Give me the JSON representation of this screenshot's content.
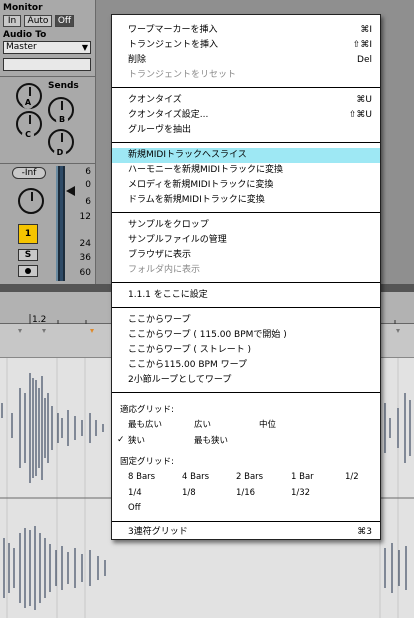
{
  "mixer": {
    "monitor_label": "Monitor",
    "monitor_in": "In",
    "monitor_auto": "Auto",
    "monitor_off": "Off",
    "audio_to_label": "Audio To",
    "audio_to_value": "Master",
    "sends_label": "Sends",
    "send_a": "A",
    "send_b": "B",
    "send_c": "C",
    "send_d": "D",
    "volume": "-Inf",
    "track_number": "1",
    "solo": "S",
    "scale": [
      "6",
      "0",
      "6",
      "12",
      "24",
      "36",
      "60"
    ]
  },
  "ruler": {
    "bar_label": "1.2"
  },
  "menu": {
    "insert_warp_marker": "ワープマーカーを挿入",
    "insert_warp_marker_sc": "⌘I",
    "insert_transient": "トランジェントを挿入",
    "insert_transient_sc": "⇧⌘I",
    "delete": "削除",
    "delete_sc": "Del",
    "reset_transients": "トランジェントをリセット",
    "quantize": "クオンタイズ",
    "quantize_sc": "⌘U",
    "quantize_settings": "クオンタイズ設定...",
    "quantize_settings_sc": "⇧⌘U",
    "extract_groove": "グルーヴを抽出",
    "slice_to_midi": "新規MIDIトラックへスライス",
    "harmony_to_midi": "ハーモニーを新規MIDIトラックに変換",
    "melody_to_midi": "メロディを新規MIDIトラックに変換",
    "drums_to_midi": "ドラムを新規MIDIトラックに変換",
    "crop_sample": "サンプルをクロップ",
    "manage_sample_file": "サンプルファイルの管理",
    "show_in_browser": "ブラウザに表示",
    "show_in_folder": "フォルダ内に表示",
    "set_1_1_1_here": "1.1.1 をここに設定",
    "warp_from_here": "ここからワープ",
    "warp_from_here_bpm": "ここからワープ ( 115.00 BPMで開始 )",
    "warp_from_here_straight": "ここからワープ ( ストレート )",
    "warp_115_from_here": "ここから115.00 BPM ワープ",
    "warp_as_2bar_loop": "2小節ループとしてワープ",
    "adaptive_grid_label": "適応グリッド:",
    "widest": "最も広い",
    "wide": "広い",
    "medium": "中位",
    "narrow": "狭い",
    "narrowest": "最も狭い",
    "fixed_grid_label": "固定グリッド:",
    "g_8bars": "8 Bars",
    "g_4bars": "4 Bars",
    "g_2bars": "2 Bars",
    "g_1bar": "1 Bar",
    "g_1_2": "1/2",
    "g_1_4": "1/4",
    "g_1_8": "1/8",
    "g_1_16": "1/16",
    "g_1_32": "1/32",
    "g_off": "Off",
    "triplet_grid": "3連符グリッド",
    "triplet_grid_sc": "⌘3",
    "checkmark": "✓"
  },
  "colors": {
    "highlight": "#9ee8f4",
    "track_yellow": "#f5c400"
  }
}
